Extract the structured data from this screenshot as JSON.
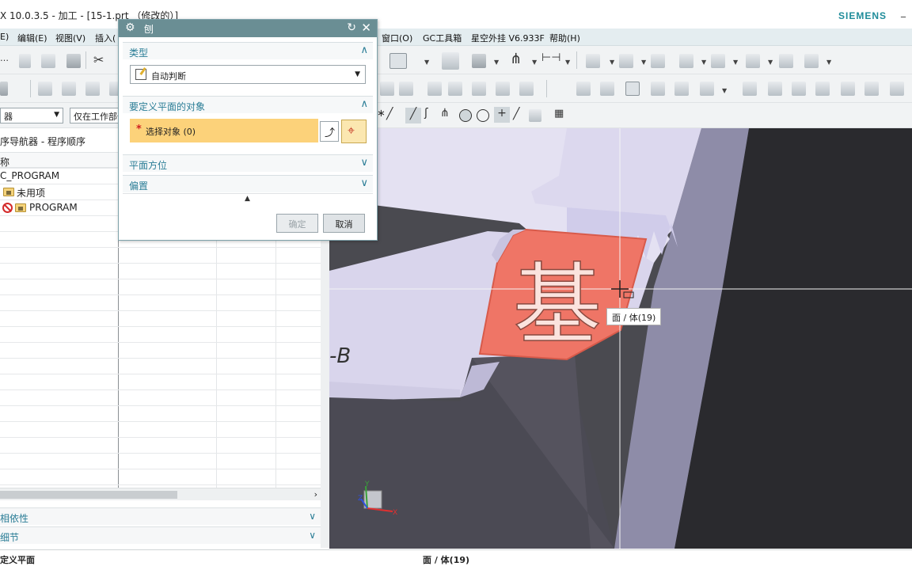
{
  "window": {
    "title": "X 10.0.3.5 - 加工 - [15-1.prt （修改的）]",
    "brand": "SIEMENS",
    "min_glyph": "_"
  },
  "menubar": {
    "items": [
      "E)",
      "编辑(E)",
      "视图(V)",
      "插入(",
      "窗口(O)",
      "GC工具箱",
      "星空外挂 V6.933F",
      "帮助(H)"
    ]
  },
  "toolbar": {
    "filter_combo": "器",
    "scope_combo": "仅在工作部件"
  },
  "navigator": {
    "title": "序导航器 - 程序顺序",
    "column_header": "称",
    "rows": [
      "C_PROGRAM",
      "未用项",
      "PROGRAM"
    ],
    "sections": [
      "相依性",
      "细节"
    ],
    "scroll_right": "›"
  },
  "dialog": {
    "title": "刨",
    "type_group": "类型",
    "type_value": "自动判断",
    "object_group": "要定义平面的对象",
    "select_star": "*",
    "select_label": "选择对象 (0)",
    "orientation_group": "平面方位",
    "offset_group": "偏置",
    "ok_label": "确定",
    "cancel_label": "取消"
  },
  "viewport": {
    "tooltip": "面 / 体(19)",
    "face_character": "基",
    "side_label": "-B",
    "triad": {
      "x": "X",
      "y": "Y",
      "z": "Z"
    }
  },
  "statusbar": {
    "left": "定义平面",
    "middle": "面 / 体(19)"
  }
}
